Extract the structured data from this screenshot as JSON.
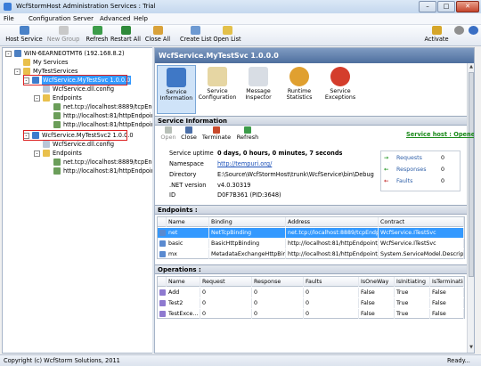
{
  "window": {
    "title": "WcfStormHost Administration Services : Trial",
    "min": "–",
    "max": "□",
    "close": "✕"
  },
  "menu": [
    "File",
    "Configuration",
    "Server",
    "Advanced",
    "Help"
  ],
  "toolbar": {
    "items": [
      "Host Service",
      "New Group",
      "Refresh",
      "Restart All",
      "Close All",
      "Create List",
      "Open List"
    ],
    "activate": "Activate"
  },
  "tree": {
    "root": "WIN-6EARNEOTMT6 (192.168.8.2)",
    "groups": [
      "My Services",
      "MyTestServices"
    ],
    "svc1": {
      "name": "WcfService.MyTestSvc 1.0.0.0",
      "config": "WcfService.dll.config",
      "endpoints": "Endpoints",
      "eps": [
        "net.tcp://localhost:8889/tcpEndpoi",
        "http://localhost:81/httpEndpoint1/",
        "http://localhost:81/httpEndpoint1/m"
      ]
    },
    "svc2": {
      "name": "WcfService.MyTestSvc2 1.0.0.0",
      "config": "WcfService.dll.config",
      "endpoints": "Endpoints",
      "eps": [
        "net.tcp://localhost:8889/tcpEndpoi",
        "http://localhost:81/httpEndpoint/2/"
      ]
    }
  },
  "panel": {
    "title": "WcfService.MyTestSvc 1.0.0.0",
    "ribbon": [
      "Service Information",
      "Service Configuration",
      "Message Inspector",
      "Runtime Statistics",
      "Service Exceptions"
    ],
    "section_info": "Service Information",
    "actions": [
      "Open",
      "Close",
      "Terminate",
      "Refresh"
    ],
    "host_status": "Service host : Opened",
    "info": {
      "uptime_label": "Service uptime",
      "uptime": "0 days, 0 hours, 0 minutes, 7 seconds",
      "ns_label": "Namespace",
      "ns": "http://tempuri.org/",
      "dir_label": "Directory",
      "dir": "E:\\Source\\WcfStormHost\\trunk\\WcfService\\bin\\Debug",
      "net_label": ".NET version",
      "net": "v4.0.30319",
      "id_label": "ID",
      "id": "D0F7B361 (PID:3648)"
    },
    "stats": [
      {
        "label": "Requests",
        "value": "0"
      },
      {
        "label": "Responses",
        "value": "0"
      },
      {
        "label": "Faults",
        "value": "0"
      }
    ],
    "endpoints_label": "Endpoints :",
    "endpoints_cols": [
      "Name",
      "Binding",
      "Address",
      "Contract"
    ],
    "endpoints": [
      [
        "net",
        "NetTcpBinding",
        "net.tcp://localhost:8889/tcpEndpoi",
        "WcfService.ITestSvc"
      ],
      [
        "basic",
        "BasicHttpBinding",
        "http://localhost:81/httpEndpoint/1",
        "WcfService.ITestSvc"
      ],
      [
        "mx",
        "MetadataExchangeHttpBinding",
        "http://localhost:81/httpEndpoint/1",
        "System.ServiceModel.Description.I"
      ]
    ],
    "ops_label": "Operations :",
    "ops_cols": [
      "Name",
      "Request",
      "Response",
      "Faults",
      "IsOneWay",
      "IsInitiating",
      "IsTerminating"
    ],
    "ops": [
      [
        "Add",
        "0",
        "0",
        "0",
        "False",
        "True",
        "False"
      ],
      [
        "Test2",
        "0",
        "0",
        "0",
        "False",
        "True",
        "False"
      ],
      [
        "TestExce...",
        "0",
        "0",
        "0",
        "False",
        "True",
        "False"
      ]
    ]
  },
  "status": {
    "left": "Copyright (c) WcfStorm Solutions, 2011",
    "right": "Ready..."
  }
}
